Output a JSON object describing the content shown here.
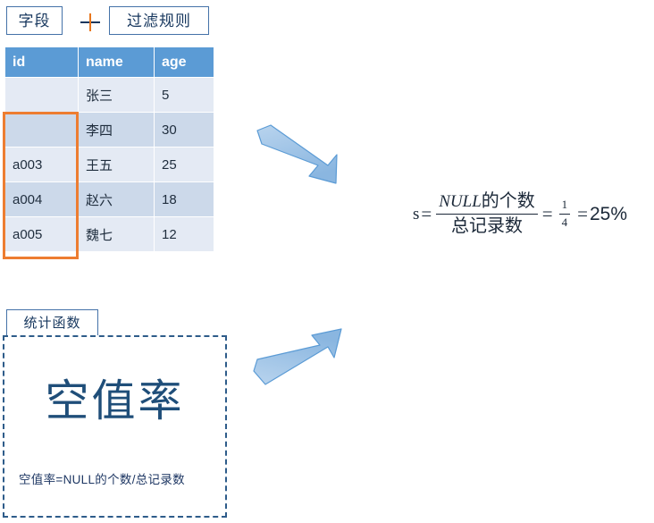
{
  "diagram": {
    "tags": {
      "field": "字段",
      "plus": "+",
      "filter_rule": "过滤规则",
      "stat_function": "统计函数"
    },
    "table": {
      "columns": [
        "id",
        "name",
        "age"
      ],
      "rows": [
        {
          "id": "",
          "name": "张三",
          "age": "5"
        },
        {
          "id": "",
          "name": "李四",
          "age": "30"
        },
        {
          "id": "a003",
          "name": "王五",
          "age": "25"
        },
        {
          "id": "a004",
          "name": "赵六",
          "age": "18"
        },
        {
          "id": "a005",
          "name": "魏七",
          "age": "12"
        }
      ],
      "highlight_note": "id 列空值区域"
    },
    "arrows": [
      {
        "name": "arrow-table-to-formula",
        "direction": "down-right"
      },
      {
        "name": "arrow-card-to-formula",
        "direction": "up-right"
      }
    ],
    "formula": {
      "lhs": "s",
      "equals": "=",
      "numerator_null": "NULL",
      "numerator_rest": "的个数",
      "denominator": "总记录数",
      "equals2": "=",
      "fraction_numerator": "1",
      "fraction_denominator": "4",
      "equals3": "=",
      "result": "25%"
    },
    "stat_card": {
      "title": "空值率",
      "subtitle": "空值率=NULL的个数/总记录数"
    },
    "colors": {
      "table_header_bg": "#5b9bd5",
      "table_row_light": "#e4eaf4",
      "table_row_dark": "#ccd9ea",
      "highlight_border": "#ed7d31",
      "arrow_fill": "#9dc3e6",
      "arrow_stroke": "#5b9bd5",
      "card_border": "#2e5c8a",
      "title_color": "#1f4e79",
      "tag_border": "#4472a8"
    }
  }
}
